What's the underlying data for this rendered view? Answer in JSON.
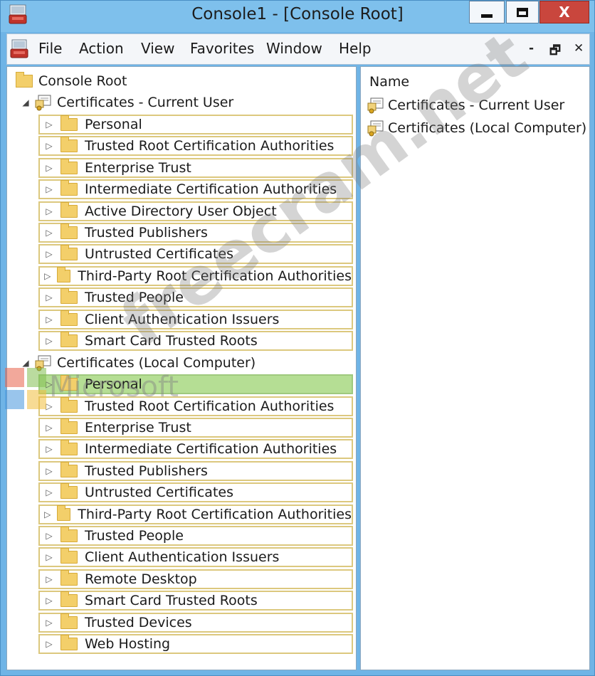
{
  "window": {
    "title": "Console1 - [Console Root]",
    "close_glyph": "X"
  },
  "menu": {
    "items": [
      "File",
      "Action",
      "View",
      "Favorites",
      "Window",
      "Help"
    ],
    "mdi": {
      "minimize": "-",
      "restore": "🗗",
      "close": "✕"
    }
  },
  "tree": {
    "root": "Console Root",
    "stores": [
      {
        "label": "Certificates - Current User",
        "children": [
          "Personal",
          "Trusted Root Certification Authorities",
          "Enterprise Trust",
          "Intermediate Certification Authorities",
          "Active Directory User Object",
          "Trusted Publishers",
          "Untrusted Certificates",
          "Third-Party Root Certification Authorities",
          "Trusted People",
          "Client Authentication Issuers",
          "Smart Card Trusted Roots"
        ]
      },
      {
        "label": "Certificates (Local Computer)",
        "children": [
          "Personal",
          "Trusted Root Certification Authorities",
          "Enterprise Trust",
          "Intermediate Certification Authorities",
          "Trusted Publishers",
          "Untrusted Certificates",
          "Third-Party Root Certification Authorities",
          "Trusted People",
          "Client Authentication Issuers",
          "Remote Desktop",
          "Smart Card Trusted Roots",
          "Trusted Devices",
          "Web Hosting"
        ]
      }
    ],
    "selected": "Certificates (Local Computer) / Personal"
  },
  "details": {
    "column_header": "Name",
    "items": [
      "Certificates - Current User",
      "Certificates (Local Computer)"
    ]
  },
  "watermark": {
    "text": "freecram.net",
    "sub": "Microsoft"
  },
  "colors": {
    "selected_row": "#b5de94",
    "folder": "#f3cf6a",
    "row_border": "#dcc87e"
  }
}
